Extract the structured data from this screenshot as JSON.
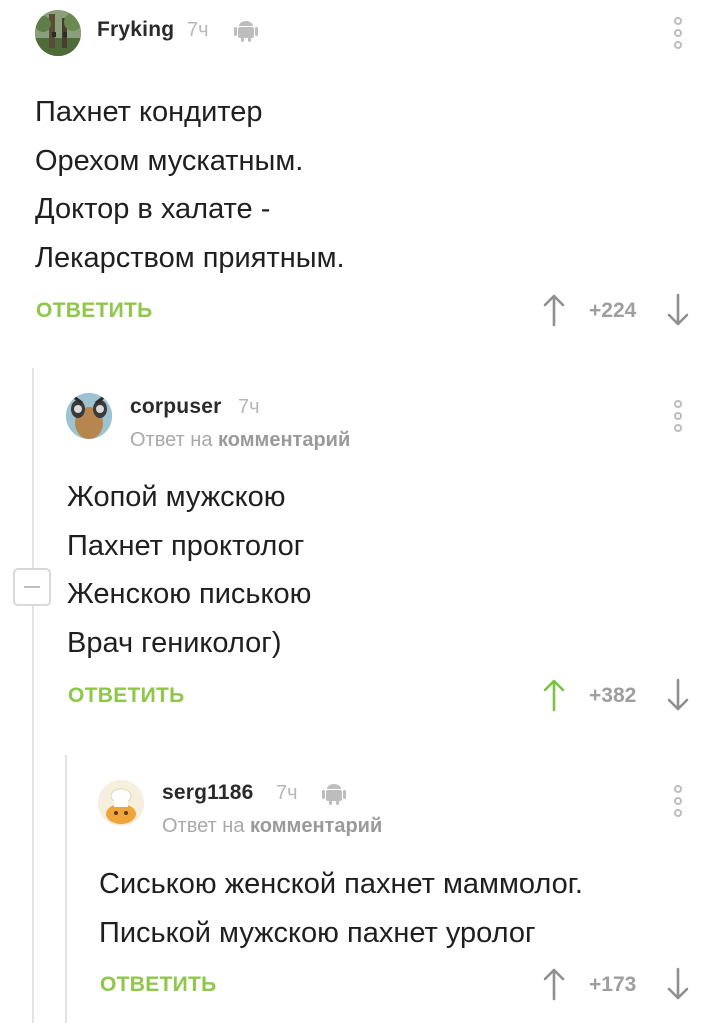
{
  "comments": [
    {
      "username": "Fryking",
      "time": "7ч",
      "lines": [
        "Пахнет кондитер",
        "Орехом мускатным.",
        "Доктор в халате -",
        "Лекарством приятным."
      ],
      "reply_label": "ОТВЕТИТЬ",
      "rating": "+224",
      "avatar_icon": "forest-avatar"
    },
    {
      "username": "corpuser",
      "time": "7ч",
      "reply_to_prefix": "Ответ на",
      "reply_to_target": "комментарий",
      "lines": [
        "Жопой мужскою",
        "Пахнет проктолог",
        "Женскою пиською",
        "Врач гениколог)"
      ],
      "reply_label": "ОТВЕТИТЬ",
      "rating": "+382",
      "upvoted": true,
      "avatar_icon": "cartoon-avatar"
    },
    {
      "username": "serg1186",
      "time": "7ч",
      "reply_to_prefix": "Ответ на",
      "reply_to_target": "комментарий",
      "lines": [
        "Сиською женской пахнет маммолог.",
        "Писькой мужскою пахнет уролог"
      ],
      "reply_label": "ОТВЕТИТЬ",
      "rating": "+173",
      "avatar_icon": "chef-avatar"
    }
  ],
  "colors": {
    "accent": "#8ec74a",
    "muted": "#a9a9a9",
    "line": "#e3e3e3"
  }
}
